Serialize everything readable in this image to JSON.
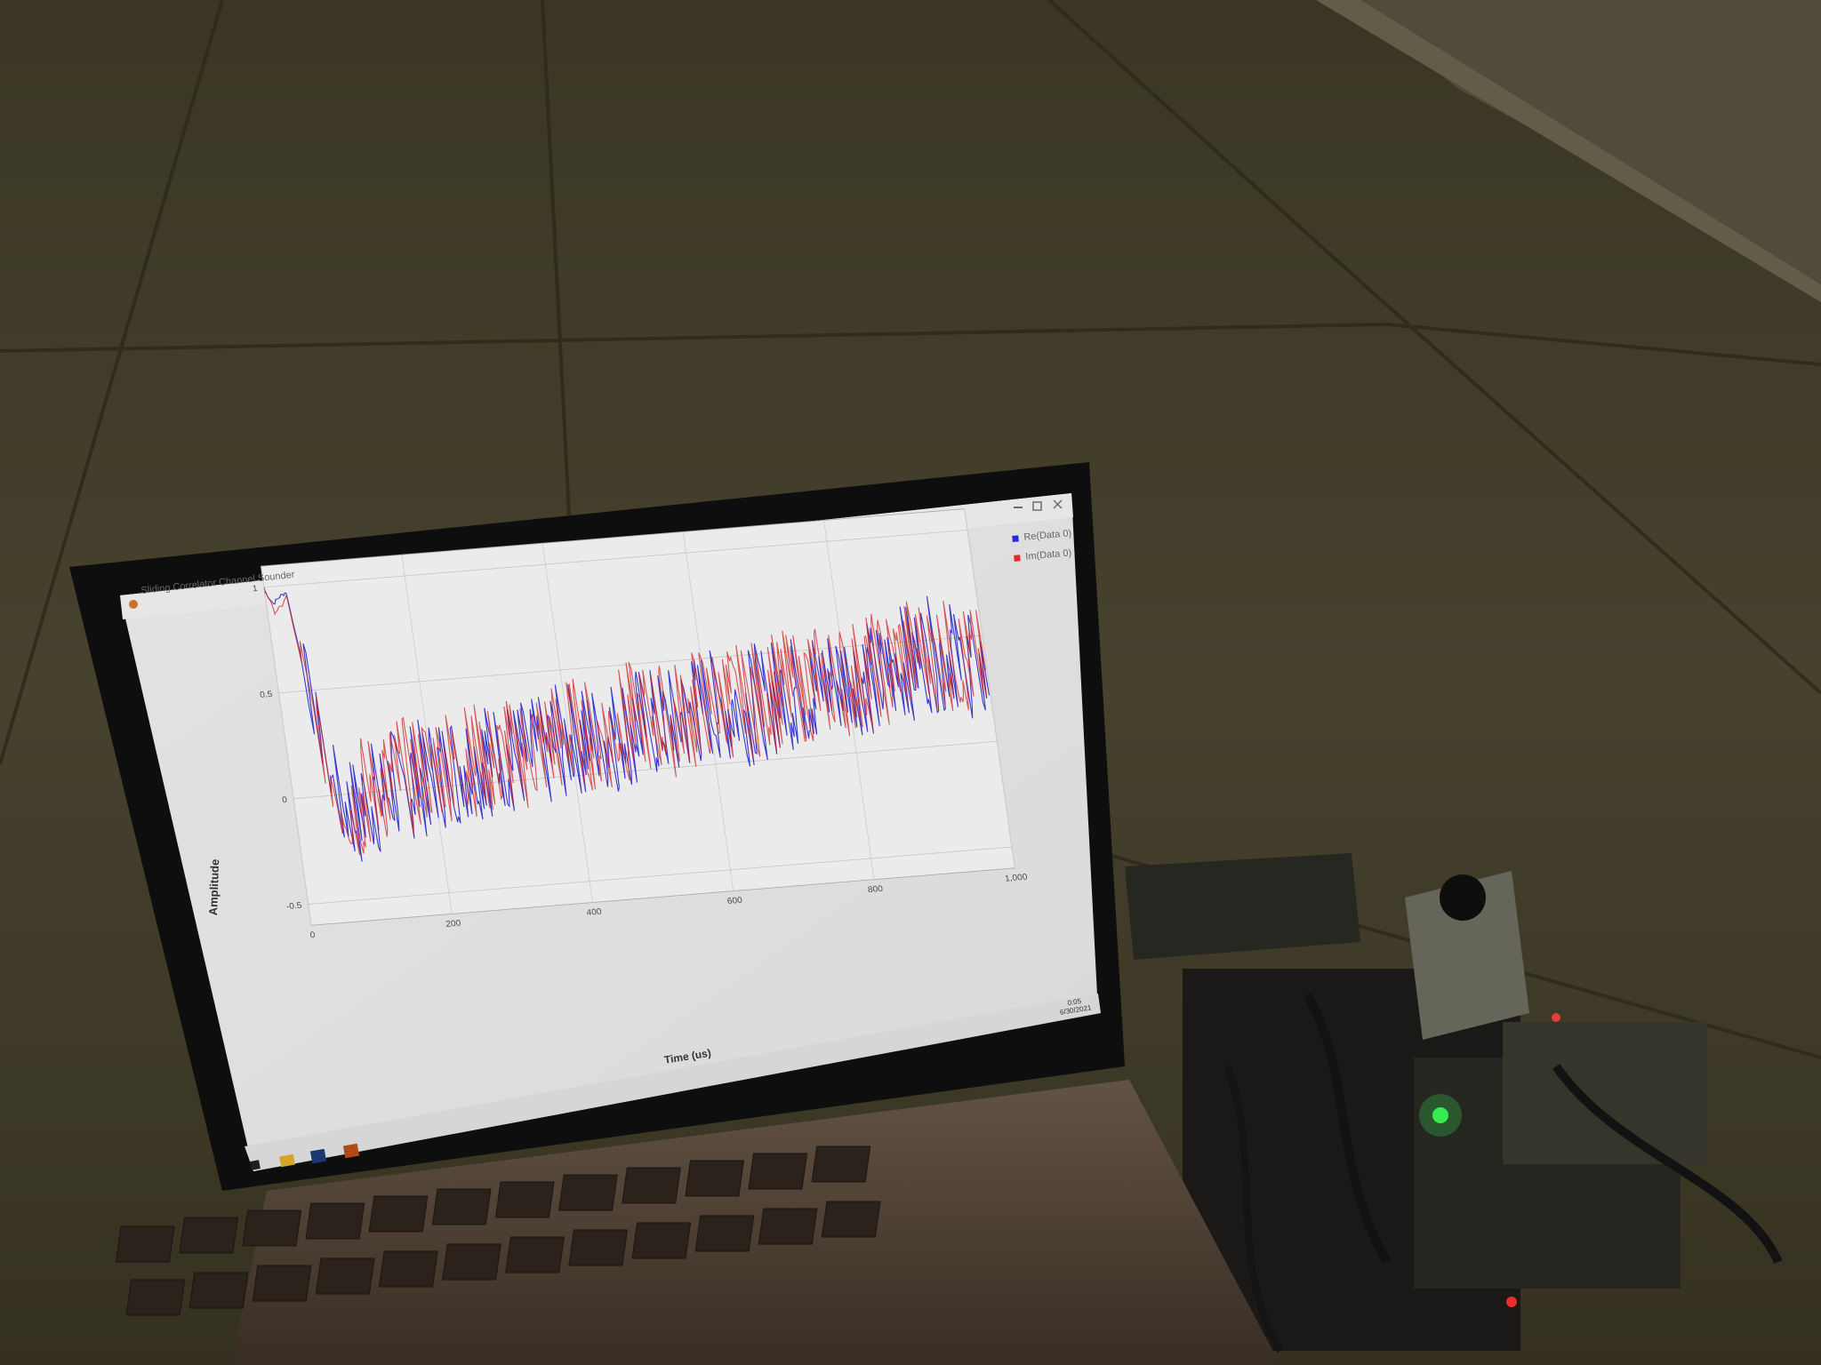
{
  "window": {
    "title": "Sliding Correlator Channel Sounder",
    "controls": [
      "minimize-icon",
      "maximize-icon",
      "close-icon"
    ]
  },
  "legend": [
    {
      "label": "Re(Data 0)",
      "color": "#2a2ae0"
    },
    {
      "label": "Im(Data 0)",
      "color": "#e02a2a"
    }
  ],
  "taskbar": {
    "clock_time": "0:05",
    "clock_date": "6/30/2021",
    "apps": [
      "windows-logo-icon",
      "file-explorer-icon",
      "app-n-icon",
      "channel-sounder-app-icon"
    ]
  },
  "chart_data": {
    "type": "line",
    "xlabel": "Time (us)",
    "ylabel": "Amplitude",
    "x_ticks": [
      "0",
      "200",
      "400",
      "600",
      "800",
      "1,000"
    ],
    "y_ticks": [
      "-0.5",
      "0",
      "0.5",
      "1"
    ],
    "xlim": [
      0,
      1000
    ],
    "ylim": [
      -0.6,
      1.1
    ],
    "grid": true,
    "legend_position": "top-right, outside plot",
    "series": [
      {
        "name": "Re(Data 0)",
        "color": "#2a2ae0",
        "x": [
          0,
          10,
          20,
          30,
          40,
          50,
          60,
          80,
          100,
          150,
          200,
          250,
          300,
          350,
          400,
          450,
          500,
          550,
          600,
          650,
          700,
          750,
          800,
          850,
          900,
          950,
          1000
        ],
        "values": [
          0.98,
          0.92,
          0.95,
          0.97,
          0.6,
          0.3,
          0.0,
          -0.1,
          -0.05,
          0.02,
          0.06,
          0.1,
          0.12,
          0.1,
          0.18,
          0.16,
          0.22,
          0.2,
          0.28,
          0.25,
          0.3,
          0.32,
          0.36,
          0.34,
          0.42,
          0.44,
          0.3
        ]
      },
      {
        "name": "Im(Data 0)",
        "color": "#e02a2a",
        "x": [
          0,
          10,
          20,
          30,
          40,
          50,
          60,
          80,
          100,
          150,
          200,
          250,
          300,
          350,
          400,
          450,
          500,
          550,
          600,
          650,
          700,
          750,
          800,
          850,
          900,
          950,
          1000
        ],
        "values": [
          1.0,
          0.88,
          0.9,
          0.95,
          0.55,
          0.25,
          0.02,
          -0.08,
          0.0,
          0.05,
          0.1,
          0.12,
          0.1,
          0.15,
          0.2,
          0.18,
          0.25,
          0.22,
          0.3,
          0.28,
          0.32,
          0.34,
          0.35,
          0.38,
          0.45,
          0.42,
          0.35
        ]
      }
    ]
  }
}
